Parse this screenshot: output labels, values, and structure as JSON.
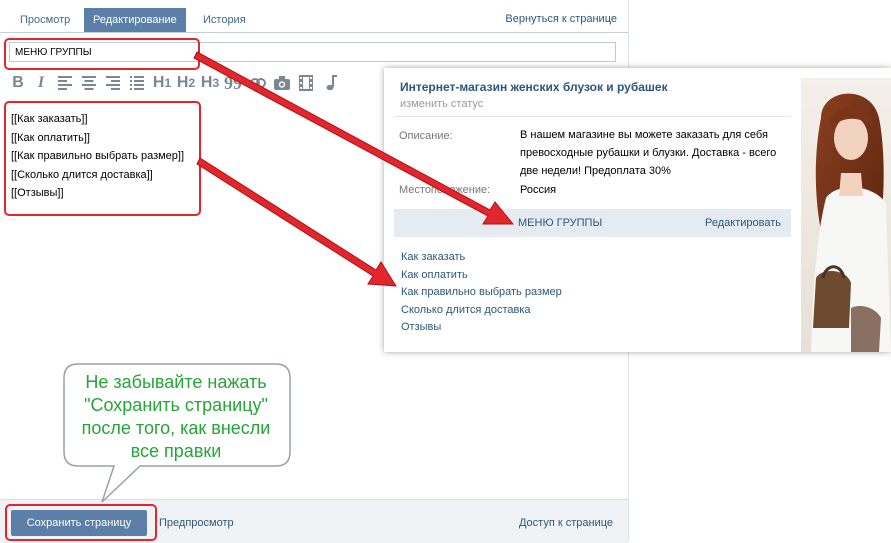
{
  "editor": {
    "tabs": [
      {
        "label": "Просмотр"
      },
      {
        "label": "Редактирование"
      },
      {
        "label": "История"
      }
    ],
    "back_link": "Вернуться к странице",
    "title_value": "МЕНЮ ГРУППЫ",
    "toolbar": {
      "bold": "B",
      "italic": "I",
      "h1": "H",
      "h2": "H",
      "h3": "H",
      "h1_sub": "1",
      "h2_sub": "2",
      "h3_sub": "3",
      "quote": "99"
    },
    "content_lines": [
      "[[Как заказать]]",
      "[[Как оплатить]]",
      "[[Как правильно выбрать размер]]",
      "[[Сколько длится доставка]]",
      "[[Отзывы]]"
    ],
    "footer": {
      "save_label": "Сохранить страницу",
      "preview_label": "Предпросмотр",
      "access_label": "Доступ к странице"
    }
  },
  "group_preview": {
    "name": "Интернет-магазин женских блузок и рубашек",
    "status_link": "изменить статус",
    "description_label": "Описание:",
    "description_value": "В нашем магазине вы можете заказать для себя превосходные рубашки и блузки. Доставка - всего две недели! Предоплата 30%",
    "location_label": "Местоположение:",
    "location_value": "Россия",
    "menu_title": "МЕНЮ ГРУППЫ",
    "edit_link": "Редактировать",
    "menu_links": [
      "Как заказать",
      "Как оплатить",
      "Как правильно выбрать размер",
      "Сколько длится доставка",
      "Отзывы"
    ]
  },
  "callout": {
    "lines": [
      "Не забывайте нажать",
      "\"Сохранить страницу\"",
      "после того, как внесли",
      "все правки"
    ]
  },
  "colors": {
    "accent": "#5b7fa6",
    "link": "#2b587a",
    "highlight_red": "#e2262d",
    "callout_text": "#27a537"
  }
}
